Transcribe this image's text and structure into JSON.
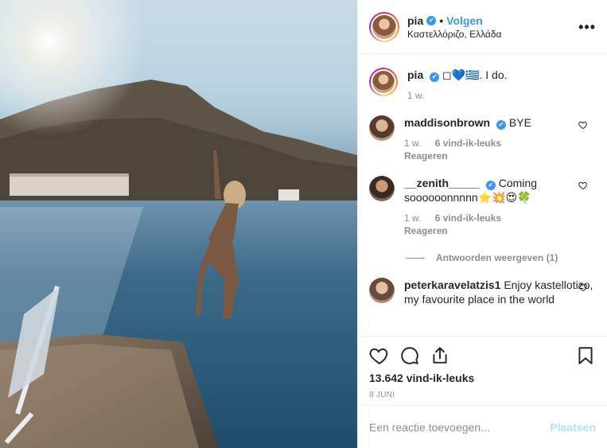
{
  "header": {
    "username": "pia",
    "separator": "•",
    "follow_label": "Volgen",
    "location": "Καστελλόριζο, Ελλάδα",
    "more_icon": "ellipsis-icon",
    "verified_mark": "✔"
  },
  "caption": {
    "username": "pia",
    "text": "◻💙🇬🇷. I do.",
    "time": "1 w."
  },
  "comments": [
    {
      "username": "maddisonbrown",
      "text": "BYE",
      "time": "1 w.",
      "likes": "6 vind-ik-leuks",
      "reply": "Reageren"
    },
    {
      "username": "__zenith_____",
      "text": "Coming soooooonnnnn⭐💥😍🍀",
      "time": "1 w.",
      "likes": "6 vind-ik-leuks",
      "reply": "Reageren"
    },
    {
      "username": "peterkaravelatzis1",
      "text": "Enjoy kastellotizo, my favourite place in the world"
    }
  ],
  "view_replies": "Antwoorden weergeven (1)",
  "actions": {
    "like_icon": "heart-icon",
    "comment_icon": "comment-icon",
    "share_icon": "share-icon",
    "save_icon": "bookmark-icon"
  },
  "likes_count": "13.642 vind-ik-leuks",
  "date": "8 JUNI",
  "add_comment": {
    "placeholder": "Een reactie toevoegen...",
    "post_label": "Plaatsen"
  },
  "colors": {
    "accent": "#3897f0",
    "post_disabled": "#b2dffc",
    "muted": "#8e8e8e",
    "text": "#262626"
  }
}
